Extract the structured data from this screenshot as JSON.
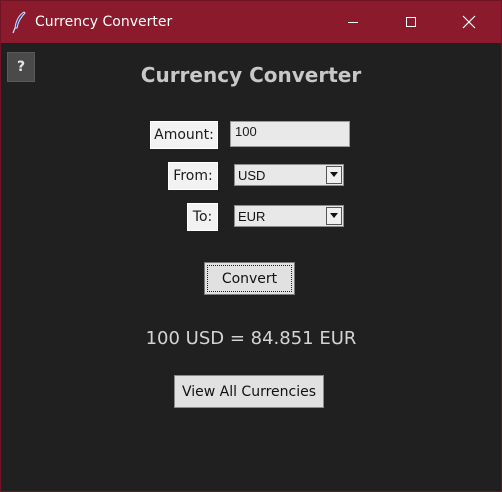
{
  "window": {
    "title": "Currency Converter",
    "icon": "feather-icon",
    "controls": [
      "minimize-icon",
      "maximize-icon",
      "close-icon"
    ]
  },
  "help_button": {
    "label": "?"
  },
  "heading": "Currency Converter",
  "form": {
    "amount_label": "Amount:",
    "amount_value": "100",
    "from_label": "From:",
    "from_value": "USD",
    "to_label": "To:",
    "to_value": "EUR"
  },
  "convert_button": {
    "label": "Convert"
  },
  "result_text": "100 USD = 84.851 EUR",
  "view_all_button": {
    "label": "View All Currencies"
  },
  "colors": {
    "titlebar": "#8b1a2c",
    "background": "#202020",
    "heading": "#c8c8c8",
    "result": "#d4d4d4"
  }
}
